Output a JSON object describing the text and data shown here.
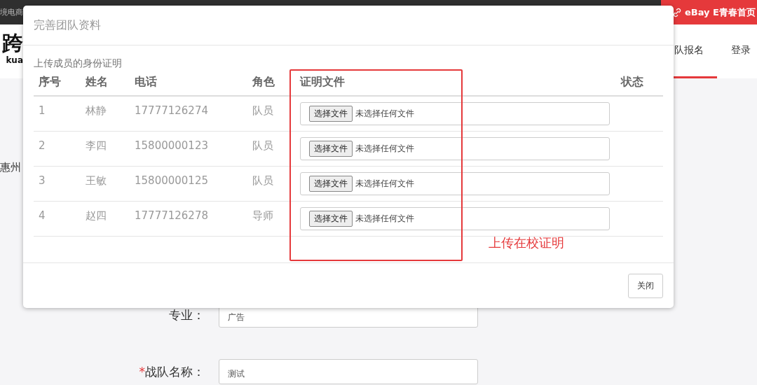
{
  "top_bar": {
    "site_name": "境电商",
    "home_link": "eBay E青春首页"
  },
  "header": {
    "logo": "跨",
    "logo_pinyin": "kua",
    "nav": [
      {
        "label": "队报名",
        "selected": true
      },
      {
        "label": "登录",
        "selected": false
      }
    ]
  },
  "page": {
    "city_text": "惠州",
    "form": [
      {
        "label": "专业：",
        "value": "广告"
      },
      {
        "mark": "*",
        "label": "战队名称：",
        "value": "测试"
      }
    ]
  },
  "modal": {
    "title": "完善团队资料",
    "section_title": "上传成员的身份证明",
    "columns": [
      "序号",
      "姓名",
      "电话",
      "角色",
      "证明文件",
      "状态"
    ],
    "rows": [
      {
        "index": "1",
        "name": "林静",
        "phone": "17777126274",
        "role": "队员",
        "file_button": "选择文件",
        "file_status": "未选择任何文件"
      },
      {
        "index": "2",
        "name": "李四",
        "phone": "15800000123",
        "role": "队员",
        "file_button": "选择文件",
        "file_status": "未选择任何文件"
      },
      {
        "index": "3",
        "name": "王敏",
        "phone": "15800000125",
        "role": "队员",
        "file_button": "选择文件",
        "file_status": "未选择任何文件"
      },
      {
        "index": "4",
        "name": "赵四",
        "phone": "17777126278",
        "role": "导师",
        "file_button": "选择文件",
        "file_status": "未选择任何文件"
      }
    ],
    "annotation": "上传在校证明",
    "close_button": "关闭"
  }
}
